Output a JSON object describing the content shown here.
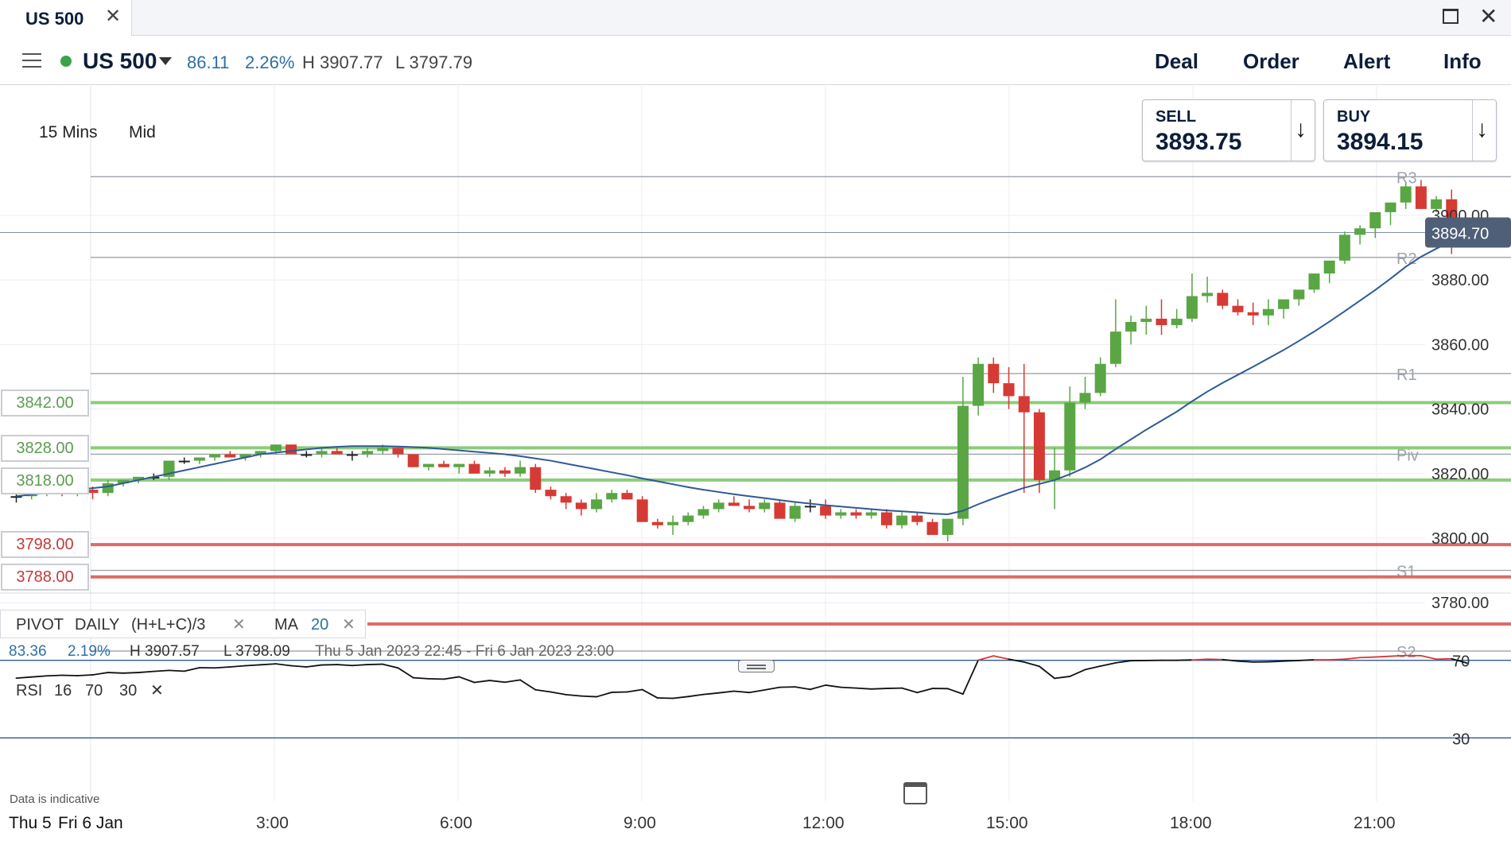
{
  "tab": {
    "title": "US 500",
    "close_icon": "close-icon"
  },
  "header": {
    "instrument": "US 500",
    "change": "86.11",
    "change_pct": "2.26%",
    "high": "H 3907.77",
    "low": "L 3797.79",
    "buttons": [
      "Deal",
      "Order",
      "Alert",
      "Info"
    ]
  },
  "chart_controls": {
    "timeframe": "15 Mins",
    "price_type": "Mid"
  },
  "sell": {
    "label": "SELL",
    "value": "3893.75"
  },
  "buy": {
    "label": "BUY",
    "value": "3894.15"
  },
  "current_price": "3894.70",
  "level_tags": [
    {
      "value": "3842.00",
      "color": "green"
    },
    {
      "value": "3828.00",
      "color": "green"
    },
    {
      "value": "3818.00",
      "color": "green"
    },
    {
      "value": "3798.00",
      "color": "red"
    },
    {
      "value": "3788.00",
      "color": "red"
    }
  ],
  "pivot_legend": {
    "name": "PIVOT",
    "period": "DAILY",
    "formula": "(H+L+C)/3"
  },
  "ma_legend": {
    "name": "MA",
    "period": "20"
  },
  "session_info": {
    "change": "83.36",
    "change_pct": "2.19%",
    "high": "H 3907.57",
    "low": "L 3798.09",
    "range": "Thu 5 Jan 2023 22:45 - Fri 6 Jan 2023 23:00"
  },
  "rsi_legend": {
    "name": "RSI",
    "period": "16",
    "upper": "70",
    "lower": "30"
  },
  "disclaimer": "Data is indicative",
  "date_label_prev": "Thu 5",
  "date_label": "Fri 6 Jan",
  "colors": {
    "up": "#5aa645",
    "down": "#d63a34",
    "ma": "#2f5a96",
    "level_green": "#8ccc7a",
    "level_red": "#e06a66",
    "rsi_over": "#d63a34"
  },
  "chart_data": {
    "type": "candlestick",
    "interval": "15 Mins",
    "y_ticks": [
      3900,
      3880,
      3860,
      3840,
      3820,
      3800,
      3780
    ],
    "y_tick_labels": [
      "3900.00",
      "3880.00",
      "3860.00",
      "3840.00",
      "3820.00",
      "3800.00",
      "3780.00"
    ],
    "x_ticks": [
      3,
      6,
      9,
      12,
      15,
      18,
      21
    ],
    "x_tick_labels": [
      "3:00",
      "6:00",
      "9:00",
      "12:00",
      "15:00",
      "18:00",
      "21:00"
    ],
    "pivot_levels": [
      {
        "name": "R3",
        "value": 3912
      },
      {
        "name": "R2",
        "value": 3887
      },
      {
        "name": "R1",
        "value": 3851
      },
      {
        "name": "Piv",
        "value": 3826
      },
      {
        "name": "S1",
        "value": 3790
      },
      {
        "name": "S2",
        "value": 3765
      }
    ],
    "ohlc": [
      [
        3813,
        3814,
        3811,
        3813
      ],
      [
        3813,
        3815,
        3812,
        3814
      ],
      [
        3814,
        3816,
        3813,
        3815
      ],
      [
        3815,
        3816,
        3813,
        3814
      ],
      [
        3814,
        3815,
        3813,
        3815
      ],
      [
        3815,
        3816,
        3812,
        3814
      ],
      [
        3814,
        3818,
        3813,
        3817
      ],
      [
        3817,
        3818,
        3816,
        3818
      ],
      [
        3818,
        3819,
        3817,
        3819
      ],
      [
        3819,
        3820,
        3818,
        3819
      ],
      [
        3819,
        3824,
        3818,
        3824
      ],
      [
        3824,
        3825,
        3823,
        3824
      ],
      [
        3824,
        3825,
        3823,
        3825
      ],
      [
        3825,
        3826,
        3824,
        3826
      ],
      [
        3826,
        3827,
        3825,
        3825
      ],
      [
        3825,
        3826,
        3824,
        3826
      ],
      [
        3826,
        3827,
        3825,
        3827
      ],
      [
        3827,
        3829,
        3826,
        3829
      ],
      [
        3829,
        3829,
        3826,
        3826
      ],
      [
        3826,
        3827,
        3825,
        3826
      ],
      [
        3826,
        3828,
        3825,
        3827
      ],
      [
        3827,
        3828,
        3826,
        3826
      ],
      [
        3826,
        3827,
        3824,
        3826
      ],
      [
        3826,
        3828,
        3825,
        3827
      ],
      [
        3827,
        3829,
        3826,
        3828
      ],
      [
        3828,
        3828,
        3825,
        3826
      ],
      [
        3826,
        3826,
        3822,
        3822
      ],
      [
        3822,
        3823,
        3821,
        3823
      ],
      [
        3823,
        3824,
        3822,
        3822
      ],
      [
        3822,
        3823,
        3820,
        3823
      ],
      [
        3823,
        3824,
        3820,
        3820
      ],
      [
        3820,
        3822,
        3819,
        3821
      ],
      [
        3821,
        3822,
        3819,
        3820
      ],
      [
        3820,
        3824,
        3819,
        3822
      ],
      [
        3822,
        3823,
        3814,
        3815
      ],
      [
        3815,
        3816,
        3812,
        3813
      ],
      [
        3813,
        3814,
        3809,
        3811
      ],
      [
        3811,
        3812,
        3807,
        3809
      ],
      [
        3809,
        3814,
        3808,
        3812
      ],
      [
        3812,
        3815,
        3811,
        3814
      ],
      [
        3814,
        3815,
        3812,
        3812
      ],
      [
        3812,
        3813,
        3805,
        3805
      ],
      [
        3805,
        3806,
        3803,
        3804
      ],
      [
        3804,
        3807,
        3801,
        3805
      ],
      [
        3805,
        3808,
        3804,
        3807
      ],
      [
        3807,
        3810,
        3806,
        3809
      ],
      [
        3809,
        3812,
        3808,
        3811
      ],
      [
        3811,
        3813,
        3810,
        3810
      ],
      [
        3810,
        3812,
        3808,
        3809
      ],
      [
        3809,
        3812,
        3808,
        3811
      ],
      [
        3811,
        3812,
        3806,
        3806
      ],
      [
        3806,
        3811,
        3805,
        3810
      ],
      [
        3810,
        3812,
        3808,
        3810
      ],
      [
        3810,
        3812,
        3806,
        3807
      ],
      [
        3807,
        3809,
        3806,
        3808
      ],
      [
        3808,
        3809,
        3806,
        3807
      ],
      [
        3807,
        3809,
        3806,
        3808
      ],
      [
        3808,
        3809,
        3803,
        3804
      ],
      [
        3804,
        3808,
        3803,
        3807
      ],
      [
        3807,
        3808,
        3804,
        3805
      ],
      [
        3805,
        3806,
        3801,
        3801
      ],
      [
        3801,
        3806,
        3799,
        3806
      ],
      [
        3806,
        3850,
        3804,
        3841
      ],
      [
        3841,
        3856,
        3838,
        3854
      ],
      [
        3854,
        3856,
        3845,
        3848
      ],
      [
        3848,
        3853,
        3840,
        3844
      ],
      [
        3844,
        3854,
        3814,
        3839
      ],
      [
        3839,
        3840,
        3814,
        3818
      ],
      [
        3818,
        3828,
        3809,
        3821
      ],
      [
        3821,
        3847,
        3819,
        3842
      ],
      [
        3842,
        3850,
        3840,
        3845
      ],
      [
        3845,
        3856,
        3844,
        3854
      ],
      [
        3854,
        3874,
        3853,
        3864
      ],
      [
        3864,
        3869,
        3860,
        3867
      ],
      [
        3867,
        3872,
        3863,
        3868
      ],
      [
        3868,
        3874,
        3863,
        3866
      ],
      [
        3866,
        3871,
        3865,
        3868
      ],
      [
        3868,
        3882,
        3867,
        3875
      ],
      [
        3875,
        3881,
        3873,
        3876
      ],
      [
        3876,
        3877,
        3871,
        3872
      ],
      [
        3872,
        3874,
        3869,
        3870
      ],
      [
        3870,
        3873,
        3866,
        3869
      ],
      [
        3869,
        3874,
        3866,
        3871
      ],
      [
        3871,
        3874,
        3868,
        3874
      ],
      [
        3874,
        3877,
        3872,
        3877
      ],
      [
        3877,
        3882,
        3876,
        3882
      ],
      [
        3882,
        3884,
        3879,
        3886
      ],
      [
        3886,
        3895,
        3885,
        3894
      ],
      [
        3894,
        3897,
        3891,
        3896
      ],
      [
        3896,
        3899,
        3893,
        3901
      ],
      [
        3901,
        3903,
        3897,
        3904
      ],
      [
        3904,
        3910,
        3902,
        3909
      ],
      [
        3909,
        3911,
        3902,
        3902
      ],
      [
        3902,
        3906,
        3901,
        3905
      ],
      [
        3905,
        3908,
        3888,
        3895
      ]
    ],
    "ma20": [
      3813,
      3813.5,
      3814,
      3814.5,
      3815,
      3815.5,
      3816,
      3817,
      3818,
      3819,
      3820,
      3821,
      3822,
      3823,
      3824,
      3825,
      3826,
      3826.5,
      3827,
      3827.5,
      3828,
      3828.3,
      3828.5,
      3828.5,
      3828.5,
      3828.4,
      3828.2,
      3828,
      3827.6,
      3827.2,
      3826.8,
      3826.4,
      3826,
      3825.4,
      3824.7,
      3824,
      3823.1,
      3822.2,
      3821.3,
      3820.4,
      3819.5,
      3818.5,
      3817.6,
      3816.7,
      3815.8,
      3815,
      3814.3,
      3813.6,
      3813,
      3812.4,
      3811.8,
      3811.2,
      3810.7,
      3810.2,
      3809.8,
      3809.4,
      3809,
      3808.6,
      3808.3,
      3808,
      3807.6,
      3807.4,
      3808.5,
      3810.5,
      3812.3,
      3814,
      3815.6,
      3816.8,
      3818,
      3819.8,
      3821.9,
      3824.4,
      3827.6,
      3830.6,
      3833.6,
      3836.4,
      3839.2,
      3842.4,
      3845.4,
      3848.1,
      3850.6,
      3853.1,
      3855.7,
      3858.3,
      3861.1,
      3864,
      3867.1,
      3870.3,
      3873.6,
      3876.9,
      3880.4,
      3884.1,
      3887.2,
      3889.7,
      3892
    ],
    "rsi": [
      [
        0,
        60.8
      ],
      [
        1,
        61.4
      ],
      [
        2,
        62
      ],
      [
        3,
        62.3
      ],
      [
        4,
        62.1
      ],
      [
        5,
        62.5
      ],
      [
        6,
        63.7
      ],
      [
        7,
        63.4
      ],
      [
        8,
        63.7
      ],
      [
        9,
        64.3
      ],
      [
        10,
        64.8
      ],
      [
        11,
        64.4
      ],
      [
        12,
        66.2
      ],
      [
        13,
        66.1
      ],
      [
        14,
        66.6
      ],
      [
        15,
        67.2
      ],
      [
        16,
        67.7
      ],
      [
        17,
        68.2
      ],
      [
        18,
        67.2
      ],
      [
        19,
        66.6
      ],
      [
        20,
        67.6
      ],
      [
        21,
        67.8
      ],
      [
        22,
        67.3
      ],
      [
        23,
        67.8
      ],
      [
        24,
        68
      ],
      [
        25,
        66.1
      ],
      [
        26,
        61
      ],
      [
        27,
        60.5
      ],
      [
        28,
        60.3
      ],
      [
        29,
        61.5
      ],
      [
        30,
        58.6
      ],
      [
        31,
        59.6
      ],
      [
        32,
        58.7
      ],
      [
        33,
        59.9
      ],
      [
        34,
        54.8
      ],
      [
        35,
        53.7
      ],
      [
        36,
        52.3
      ],
      [
        37,
        51.6
      ],
      [
        38,
        51.2
      ],
      [
        39,
        53.5
      ],
      [
        40,
        53.7
      ],
      [
        41,
        54.9
      ],
      [
        42,
        50.6
      ],
      [
        43,
        50.4
      ],
      [
        44,
        51.3
      ],
      [
        45,
        52.4
      ],
      [
        46,
        53.2
      ],
      [
        47,
        54.1
      ],
      [
        48,
        53.4
      ],
      [
        49,
        54.7
      ],
      [
        50,
        56.1
      ],
      [
        51,
        56.3
      ],
      [
        52,
        55
      ],
      [
        53,
        57.2
      ],
      [
        54,
        56.1
      ],
      [
        55,
        55.7
      ],
      [
        56,
        55.2
      ],
      [
        57,
        55.5
      ],
      [
        58,
        55.7
      ],
      [
        59,
        53.4
      ],
      [
        60,
        55.5
      ],
      [
        61,
        55.4
      ],
      [
        62,
        52.6
      ],
      [
        63,
        70.1
      ],
      [
        64,
        72.3
      ],
      [
        65,
        70.6
      ],
      [
        66,
        69.1
      ],
      [
        67,
        66.9
      ],
      [
        68,
        60.7
      ],
      [
        69,
        61.7
      ],
      [
        70,
        65.2
      ],
      [
        71,
        67
      ],
      [
        72,
        68.7
      ],
      [
        73,
        69.8
      ],
      [
        74,
        69.9
      ],
      [
        75,
        70
      ],
      [
        76,
        70
      ],
      [
        77,
        70.2
      ],
      [
        78,
        70.6
      ],
      [
        79,
        70.4
      ],
      [
        80,
        69.6
      ],
      [
        81,
        69.1
      ],
      [
        82,
        69.2
      ],
      [
        83,
        69.6
      ],
      [
        84,
        69.9
      ],
      [
        85,
        70.3
      ],
      [
        86,
        70.3
      ],
      [
        87,
        70.6
      ],
      [
        88,
        71.4
      ],
      [
        89,
        71.7
      ],
      [
        90,
        72.1
      ],
      [
        91,
        72.5
      ],
      [
        92,
        72.4
      ],
      [
        93,
        70.6
      ],
      [
        94,
        70.8
      ],
      [
        95,
        68.6
      ]
    ]
  }
}
